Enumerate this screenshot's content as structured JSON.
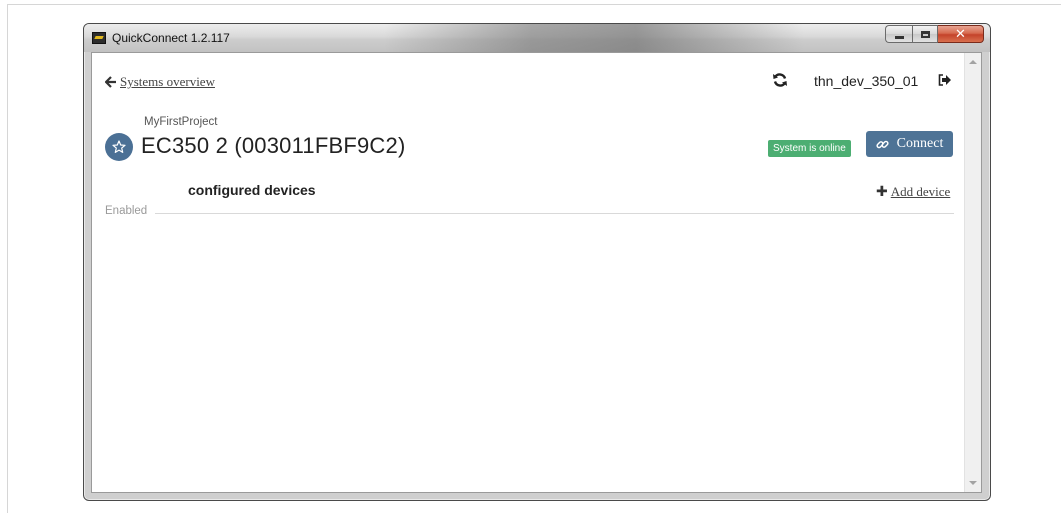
{
  "window": {
    "title": "QuickConnect 1.2.117",
    "icon": "app-logo-icon",
    "close_glyph": "✕"
  },
  "header": {
    "back_label": "Systems overview",
    "back_icon": "arrow-left-icon",
    "refresh_icon": "refresh-icon",
    "username": "thn_dev_350_01",
    "logout_icon": "logout-icon"
  },
  "system": {
    "project": "MyFirstProject",
    "title": "EC350 2 (003011FBF9C2)",
    "favorite_icon": "star-icon",
    "status": "System is online",
    "status_color": "#4cae72",
    "connect_label": "Connect",
    "connect_icon": "link-icon",
    "accent_color": "#4e7396"
  },
  "devices": {
    "heading": "configured devices",
    "add_label": "Add device",
    "add_glyph": "✚",
    "group_label": "Enabled"
  }
}
